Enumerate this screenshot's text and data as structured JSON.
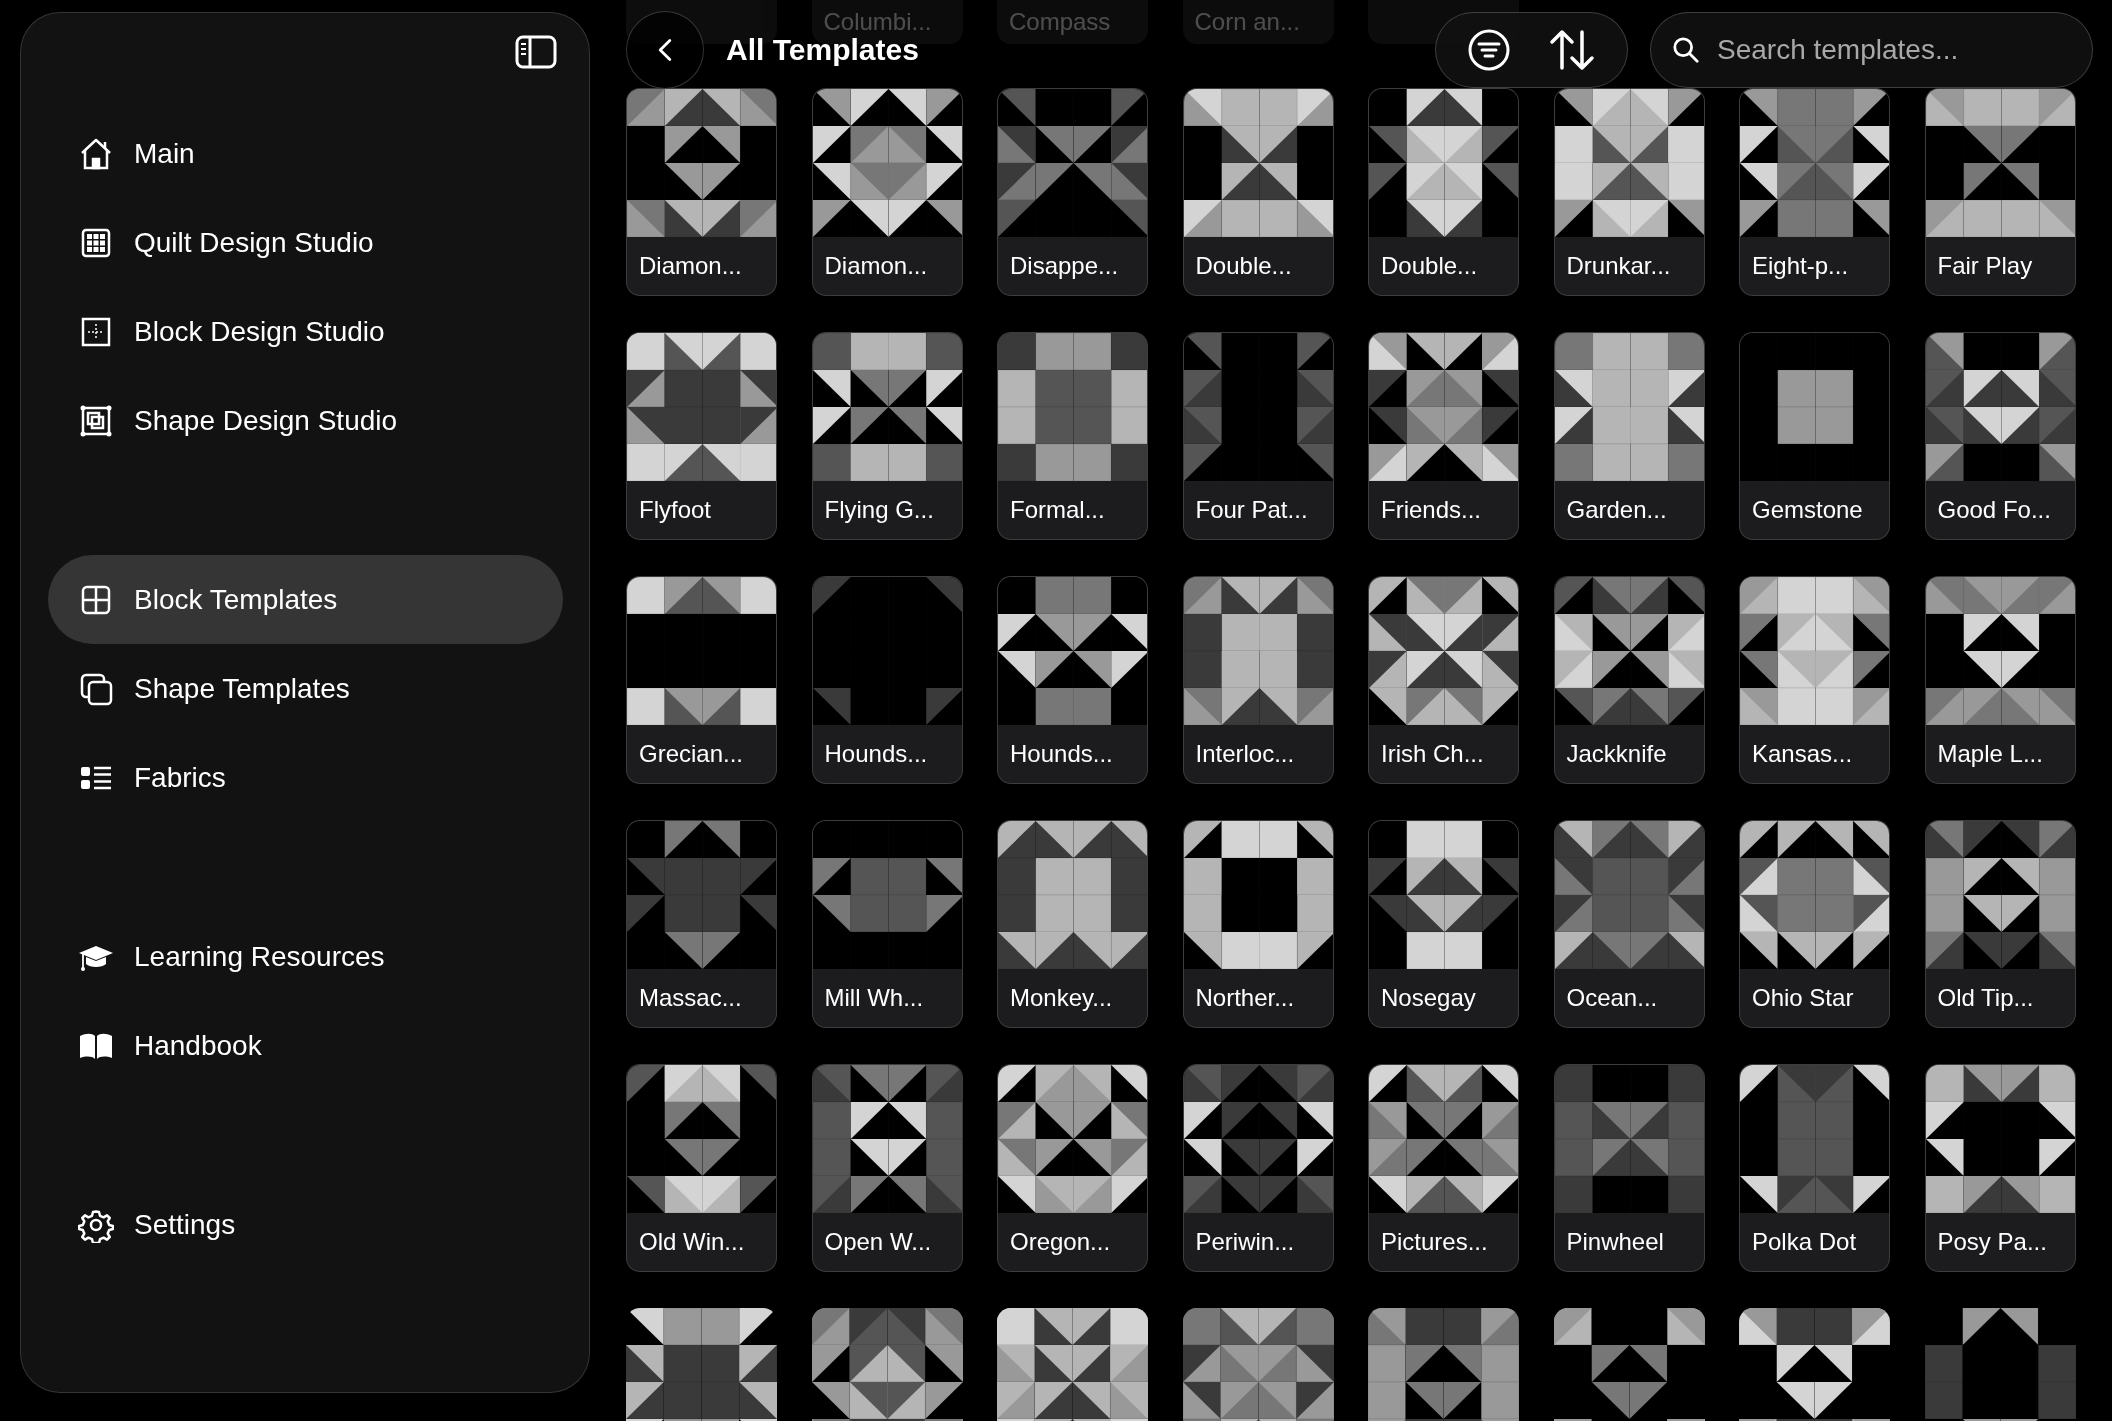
{
  "sidebar": {
    "groups": [
      {
        "items": [
          {
            "label": "Main",
            "selected": false
          },
          {
            "label": "Quilt Design Studio",
            "selected": false
          },
          {
            "label": "Block Design Studio",
            "selected": false
          },
          {
            "label": "Shape Design Studio",
            "selected": false
          }
        ]
      },
      {
        "items": [
          {
            "label": "Block Templates",
            "selected": true
          },
          {
            "label": "Shape Templates",
            "selected": false
          },
          {
            "label": "Fabrics",
            "selected": false
          }
        ]
      },
      {
        "items": [
          {
            "label": "Learning Resources",
            "selected": false
          },
          {
            "label": "Handbook",
            "selected": false
          }
        ]
      },
      {
        "items": [
          {
            "label": "Settings",
            "selected": false
          }
        ]
      }
    ]
  },
  "header": {
    "title": "All Templates",
    "search": {
      "placeholder": "Search templates..."
    }
  },
  "scrolled_under_header": [
    "Columbi...",
    "Compass",
    "Corn an..."
  ],
  "templates": [
    {
      "kind": "full",
      "name": "Diamon..."
    },
    {
      "kind": "full",
      "name": "Diamon..."
    },
    {
      "kind": "full",
      "name": "Disappe..."
    },
    {
      "kind": "full",
      "name": "Double..."
    },
    {
      "kind": "full",
      "name": "Double..."
    },
    {
      "kind": "full",
      "name": "Drunkar..."
    },
    {
      "kind": "full",
      "name": "Eight-p..."
    },
    {
      "kind": "full",
      "name": "Fair Play"
    },
    {
      "kind": "full",
      "name": "Flyfoot"
    },
    {
      "kind": "full",
      "name": "Flying G..."
    },
    {
      "kind": "full",
      "name": "Formal..."
    },
    {
      "kind": "full",
      "name": "Four Pat..."
    },
    {
      "kind": "full",
      "name": "Friends..."
    },
    {
      "kind": "full",
      "name": "Garden..."
    },
    {
      "kind": "full",
      "name": "Gemstone"
    },
    {
      "kind": "full",
      "name": "Good Fo..."
    },
    {
      "kind": "full",
      "name": "Grecian..."
    },
    {
      "kind": "full",
      "name": "Hounds..."
    },
    {
      "kind": "full",
      "name": "Hounds..."
    },
    {
      "kind": "full",
      "name": "Interloc..."
    },
    {
      "kind": "full",
      "name": "Irish Ch..."
    },
    {
      "kind": "full",
      "name": "Jackknife"
    },
    {
      "kind": "full",
      "name": "Kansas..."
    },
    {
      "kind": "full",
      "name": "Maple L..."
    },
    {
      "kind": "full",
      "name": "Massac..."
    },
    {
      "kind": "full",
      "name": "Mill Wh..."
    },
    {
      "kind": "full",
      "name": "Monkey..."
    },
    {
      "kind": "full",
      "name": "Norther..."
    },
    {
      "kind": "full",
      "name": "Nosegay"
    },
    {
      "kind": "full",
      "name": "Ocean..."
    },
    {
      "kind": "full",
      "name": "Ohio Star"
    },
    {
      "kind": "full",
      "name": "Old Tip..."
    },
    {
      "kind": "full",
      "name": "Old Win..."
    },
    {
      "kind": "full",
      "name": "Open W..."
    },
    {
      "kind": "full",
      "name": "Oregon..."
    },
    {
      "kind": "full",
      "name": "Periwin..."
    },
    {
      "kind": "full",
      "name": "Pictures..."
    },
    {
      "kind": "full",
      "name": "Pinwheel"
    },
    {
      "kind": "full",
      "name": "Polka Dot"
    },
    {
      "kind": "full",
      "name": "Posy Pa..."
    },
    {
      "kind": "partial"
    },
    {
      "kind": "partial"
    },
    {
      "kind": "partial"
    },
    {
      "kind": "partial"
    },
    {
      "kind": "partial"
    },
    {
      "kind": "partial"
    },
    {
      "kind": "partial"
    },
    {
      "kind": "partial"
    }
  ]
}
